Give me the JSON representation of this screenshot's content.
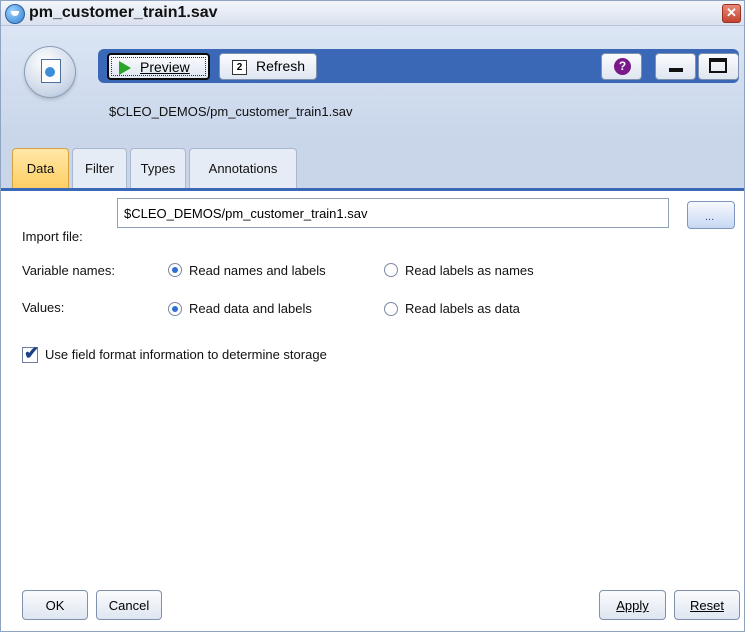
{
  "window": {
    "title": "pm_customer_train1.sav"
  },
  "toolbar": {
    "preview_label": "Preview",
    "refresh_label": "Refresh",
    "file_path": "$CLEO_DEMOS/pm_customer_train1.sav"
  },
  "tabs": [
    {
      "label": "Data",
      "active": true
    },
    {
      "label": "Filter",
      "active": false
    },
    {
      "label": "Types",
      "active": false
    },
    {
      "label": "Annotations",
      "active": false
    }
  ],
  "form": {
    "import_file_label": "Import file:",
    "import_file_value": "$CLEO_DEMOS/pm_customer_train1.sav",
    "browse_label": "...",
    "variable_names": {
      "label": "Variable names:",
      "options": [
        "Read names and labels",
        "Read labels as names"
      ],
      "selected": "Read names and labels"
    },
    "values": {
      "label": "Values:",
      "options": [
        "Read data and labels",
        "Read labels as data"
      ],
      "selected": "Read data and labels"
    },
    "use_field_format": {
      "label": "Use field format information to determine storage",
      "checked": true
    }
  },
  "buttons": {
    "ok": "OK",
    "cancel": "Cancel",
    "apply": "Apply",
    "reset": "Reset"
  },
  "icons": [
    "node-source-icon",
    "play-icon",
    "refresh-icon",
    "help-icon",
    "minimize-icon",
    "maximize-icon",
    "close-icon"
  ],
  "colors": {
    "active_tab": "#ffcf63",
    "toolbar_strip": "#3a68b6",
    "radio_selected": "#2f6fd0"
  }
}
